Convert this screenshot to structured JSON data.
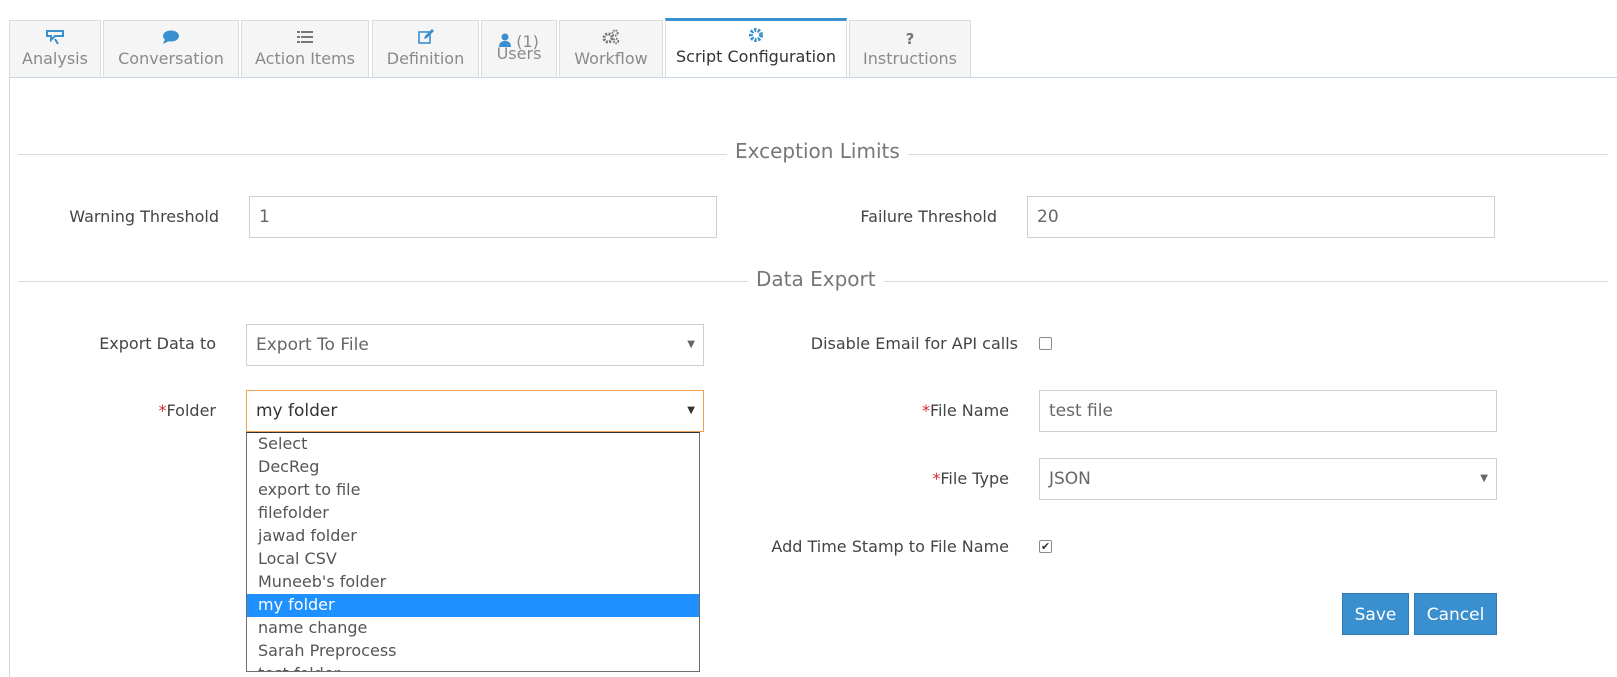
{
  "tabs": [
    {
      "label": "Analysis",
      "icon": "analysis-icon"
    },
    {
      "label": "Conversation",
      "icon": "comment-icon"
    },
    {
      "label": "Action Items",
      "icon": "list-icon"
    },
    {
      "label": "Definition",
      "icon": "edit-icon"
    },
    {
      "label": "Users",
      "count": "(1)",
      "icon": "user-icon"
    },
    {
      "label": "Workflow",
      "icon": "gears-icon"
    },
    {
      "label": "Script Configuration",
      "icon": "gear-icon",
      "active": true
    },
    {
      "label": "Instructions",
      "icon": "question-icon"
    }
  ],
  "exception_limits": {
    "title": "Exception Limits",
    "warning_label": "Warning Threshold",
    "warning_value": "1",
    "failure_label": "Failure Threshold",
    "failure_value": "20"
  },
  "data_export": {
    "title": "Data Export",
    "export_label": "Export Data to",
    "export_value": "Export To File",
    "folder_required": "*",
    "folder_label": "Folder",
    "folder_value": "my folder",
    "disable_email_label": "Disable Email for API calls",
    "disable_email_checked": false,
    "file_name_required": "*",
    "file_name_label": "File Name",
    "file_name_value": "test file",
    "file_type_required": "*",
    "file_type_label": "File Type",
    "file_type_value": "JSON",
    "timestamp_label": "Add Time Stamp to File Name",
    "timestamp_checked": true
  },
  "folder_options": [
    "Select",
    "DecReg",
    "export to file",
    "filefolder",
    "jawad folder",
    "Local CSV",
    "Muneeb's folder",
    "my folder",
    "name change",
    "Sarah Preprocess",
    "test folder"
  ],
  "folder_selected_index": 7,
  "buttons": {
    "save": "Save",
    "cancel": "Cancel"
  },
  "colors": {
    "accent": "#3a8fcf",
    "selection": "#1e90ff",
    "required": "#d9272e",
    "focus_border": "#f0a052"
  }
}
